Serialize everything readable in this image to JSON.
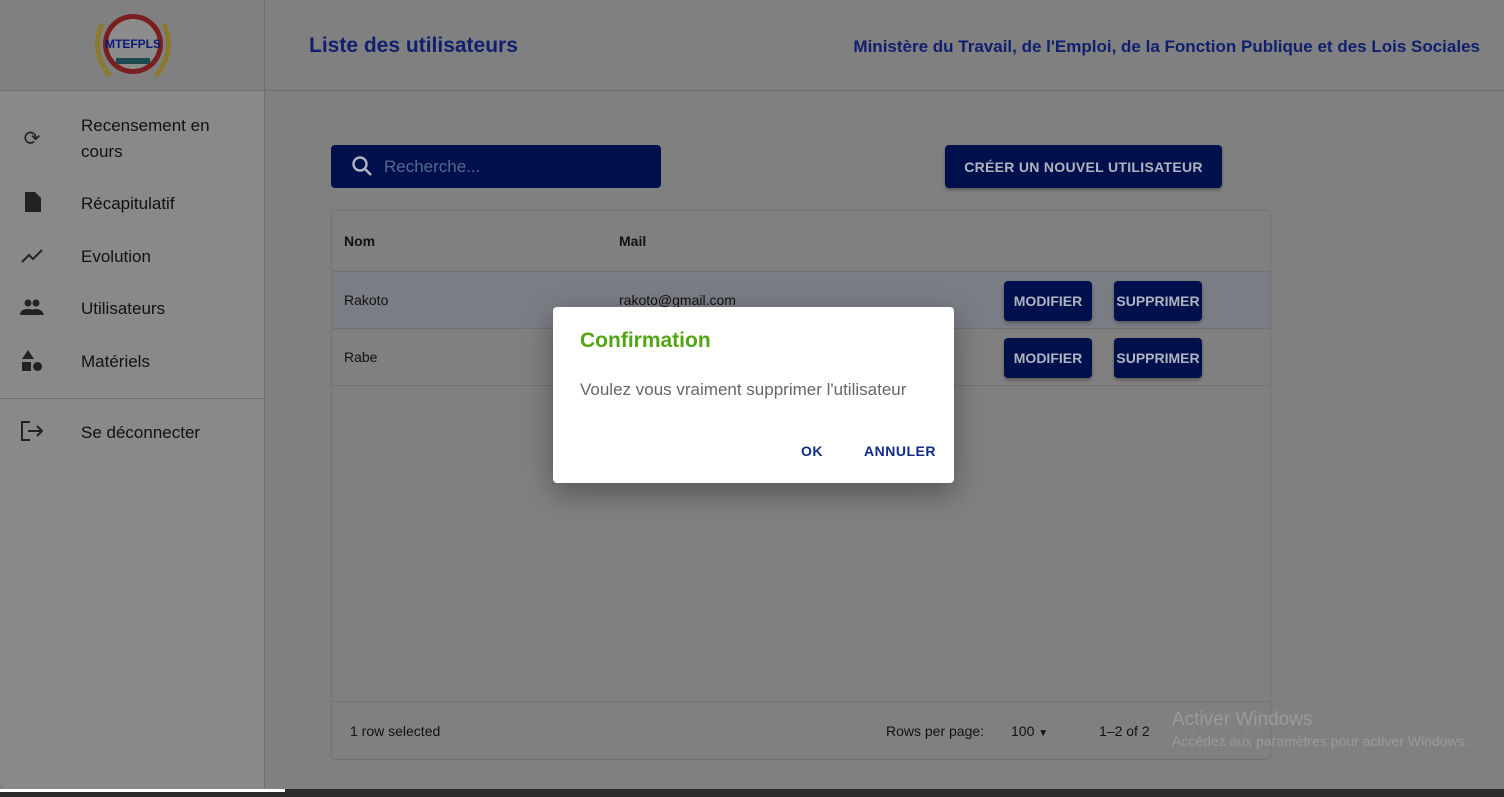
{
  "header": {
    "title": "Liste des utilisateurs",
    "ministry": "Ministère du Travail, de l'Emploi, de la Fonction Publique et des Lois Sociales",
    "logo_text": "MTEFPLS"
  },
  "sidebar": {
    "items": [
      {
        "label": "Recensement en cours",
        "icon": "sync-icon"
      },
      {
        "label": "Récapitulatif",
        "icon": "document-icon"
      },
      {
        "label": "Evolution",
        "icon": "trending-icon"
      },
      {
        "label": "Utilisateurs",
        "icon": "people-icon"
      },
      {
        "label": "Matériels",
        "icon": "shapes-icon"
      }
    ],
    "logout": "Se déconnecter"
  },
  "search": {
    "placeholder": "Recherche..."
  },
  "create_button": "CRÉER UN NOUVEL UTILISATEUR",
  "table": {
    "columns": [
      "Nom",
      "Mail"
    ],
    "rows": [
      {
        "nom": "Rakoto",
        "mail": "rakoto@gmail.com",
        "selected": true
      },
      {
        "nom": "Rabe",
        "mail": "",
        "selected": false
      }
    ],
    "modify_label": "MODIFIER",
    "delete_label": "SUPPRIMER"
  },
  "footer": {
    "selected": "1 row selected",
    "rows_per_page_label": "Rows per page:",
    "rows_per_page": "100",
    "range": "1–2 of 2"
  },
  "dialog": {
    "title": "Confirmation",
    "message": "Voulez vous vraiment supprimer l'utilisateur",
    "ok": "OK",
    "cancel": "ANNULER"
  },
  "watermark": {
    "title": "Activer Windows",
    "subtitle": "Accédez aux paramètres pour activer Windows."
  }
}
